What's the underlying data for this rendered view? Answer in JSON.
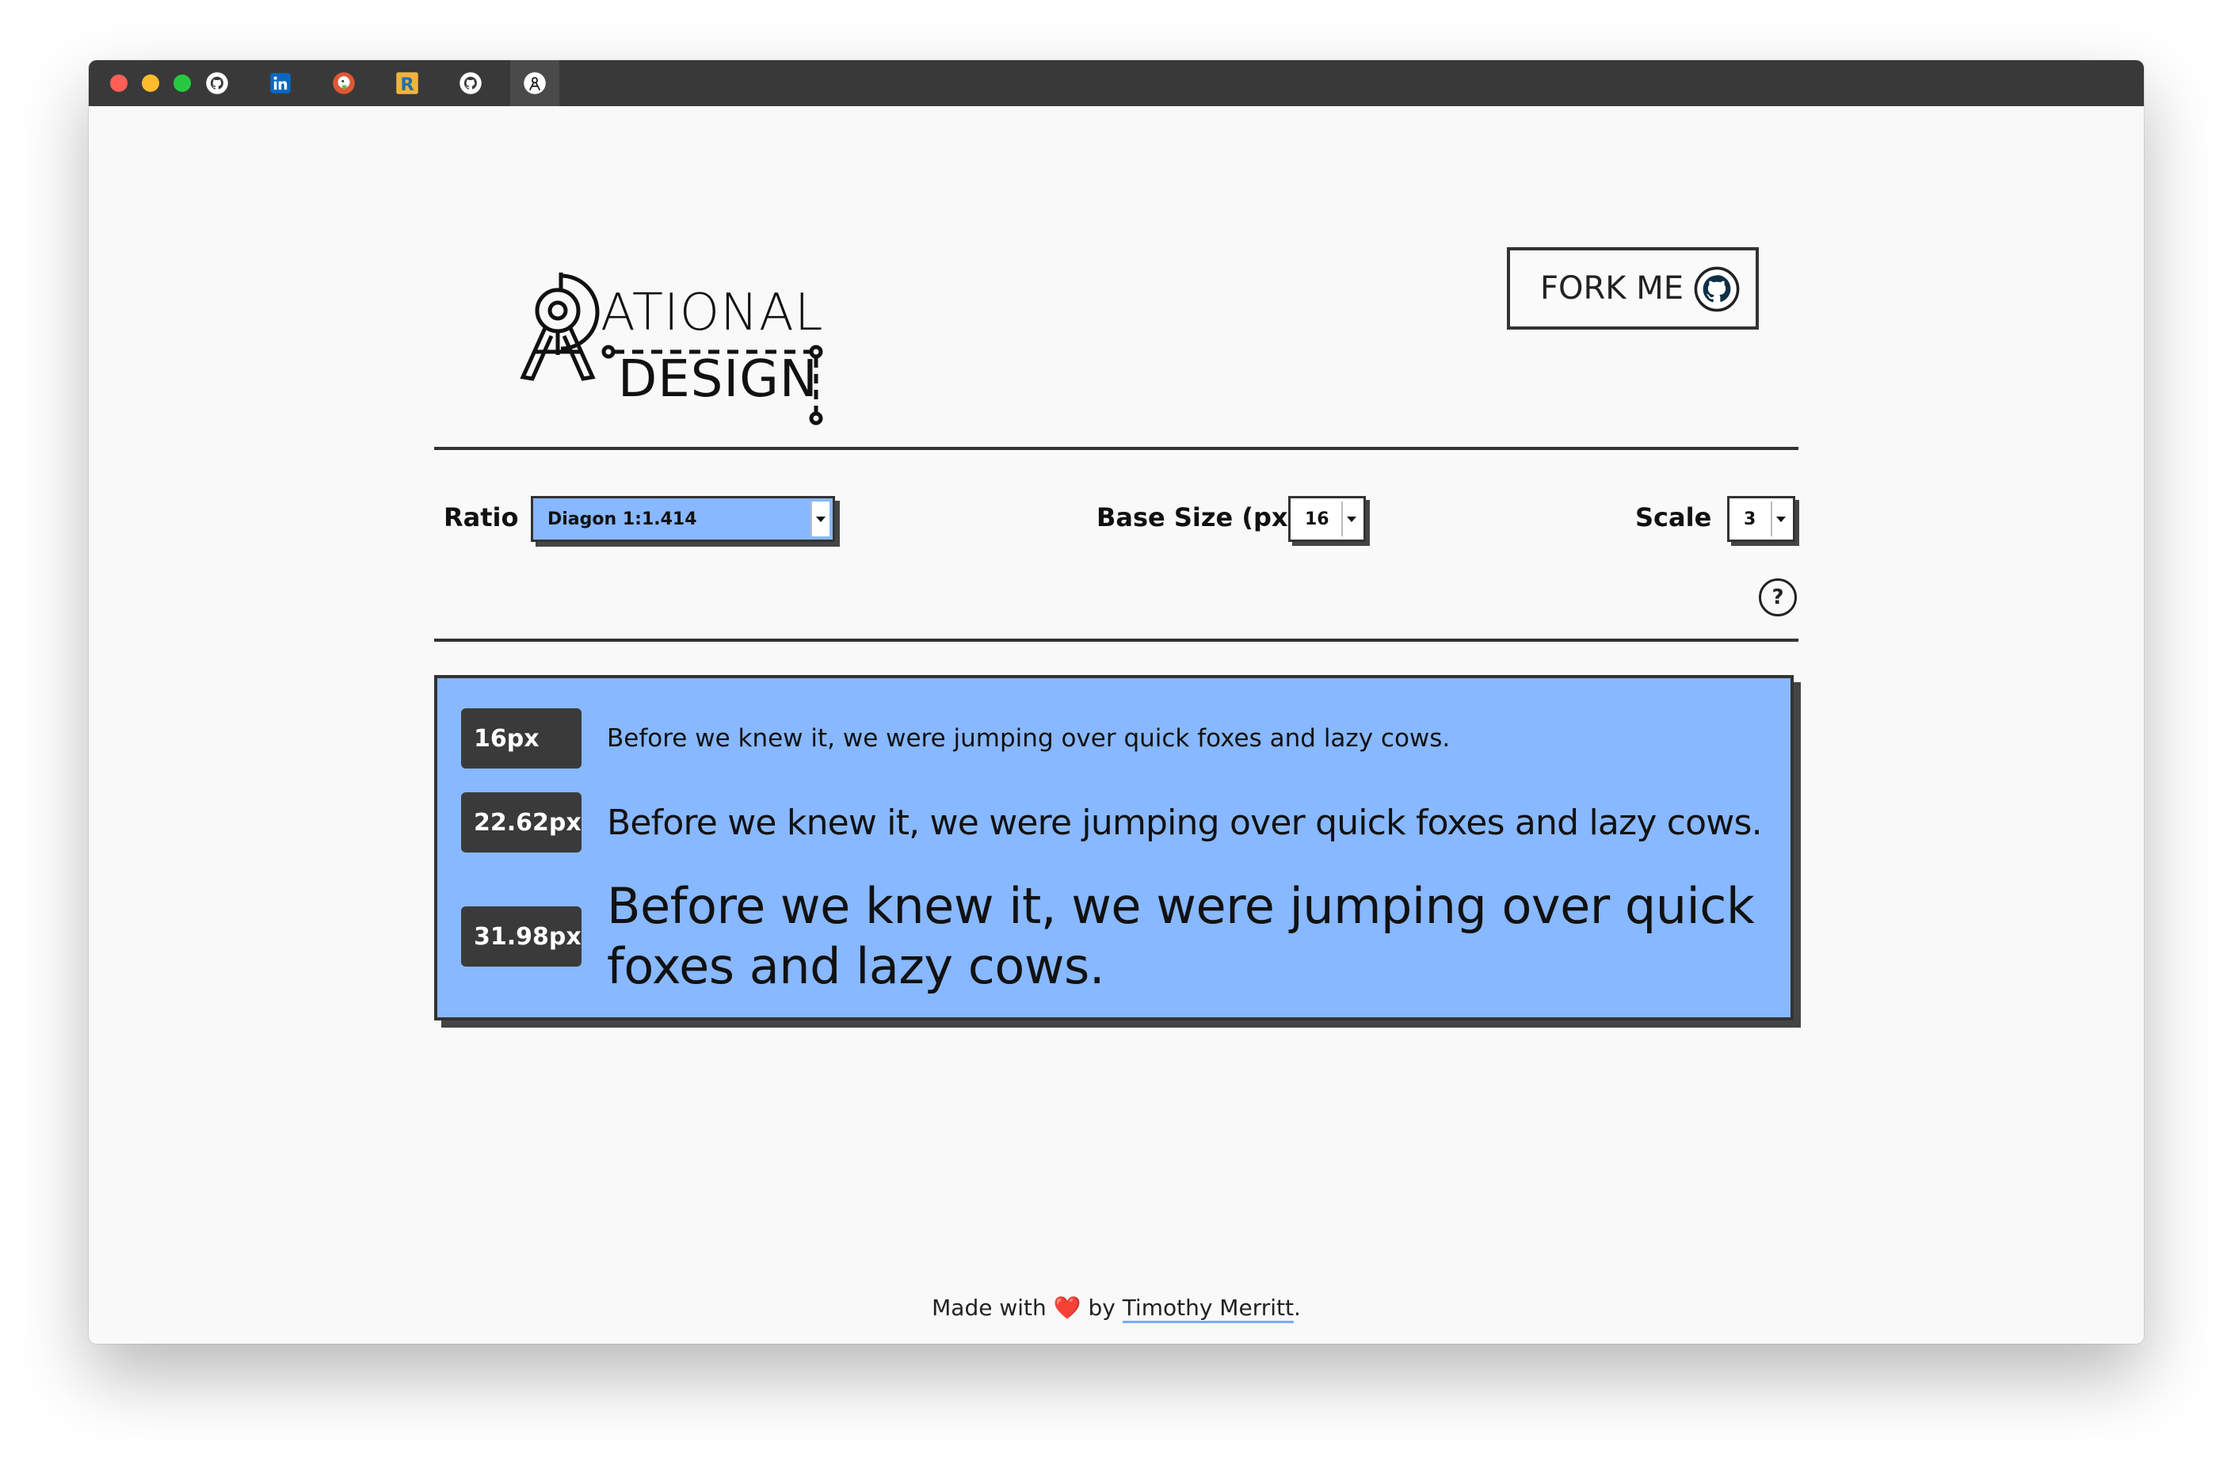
{
  "window": {
    "tab_icons": [
      "github-icon",
      "linkedin-icon",
      "duckduckgo-icon",
      "r-letter-icon",
      "github-icon",
      "compass-icon"
    ]
  },
  "logo": {
    "line1": "ATIONAL",
    "line2": "DESIGN"
  },
  "fork_button": {
    "label": "FORK ME",
    "icon": "github-icon"
  },
  "controls": {
    "ratio_label": "Ratio",
    "ratio_value": "Diagon 1:1.414",
    "base_label": "Base Size (px)",
    "base_value": "16",
    "scale_label": "Scale",
    "scale_value": "3",
    "help_label": "?"
  },
  "preview": {
    "rows": [
      {
        "size": "16px",
        "text": "Before we knew it, we were jumping over quick foxes and lazy cows."
      },
      {
        "size": "22.62px",
        "text": "Before we knew it, we were jumping over quick foxes and lazy cows."
      },
      {
        "size": "31.98px",
        "text": "Before we knew it, we were jumping over quick foxes and lazy cows."
      }
    ]
  },
  "footer": {
    "made_with": "Made with",
    "heart": "❤️",
    "by": "by",
    "author": "Timothy Merritt",
    "period": "."
  },
  "colors": {
    "accent": "#88b8ff",
    "dark": "#333333",
    "background": "#f9f9f9"
  }
}
